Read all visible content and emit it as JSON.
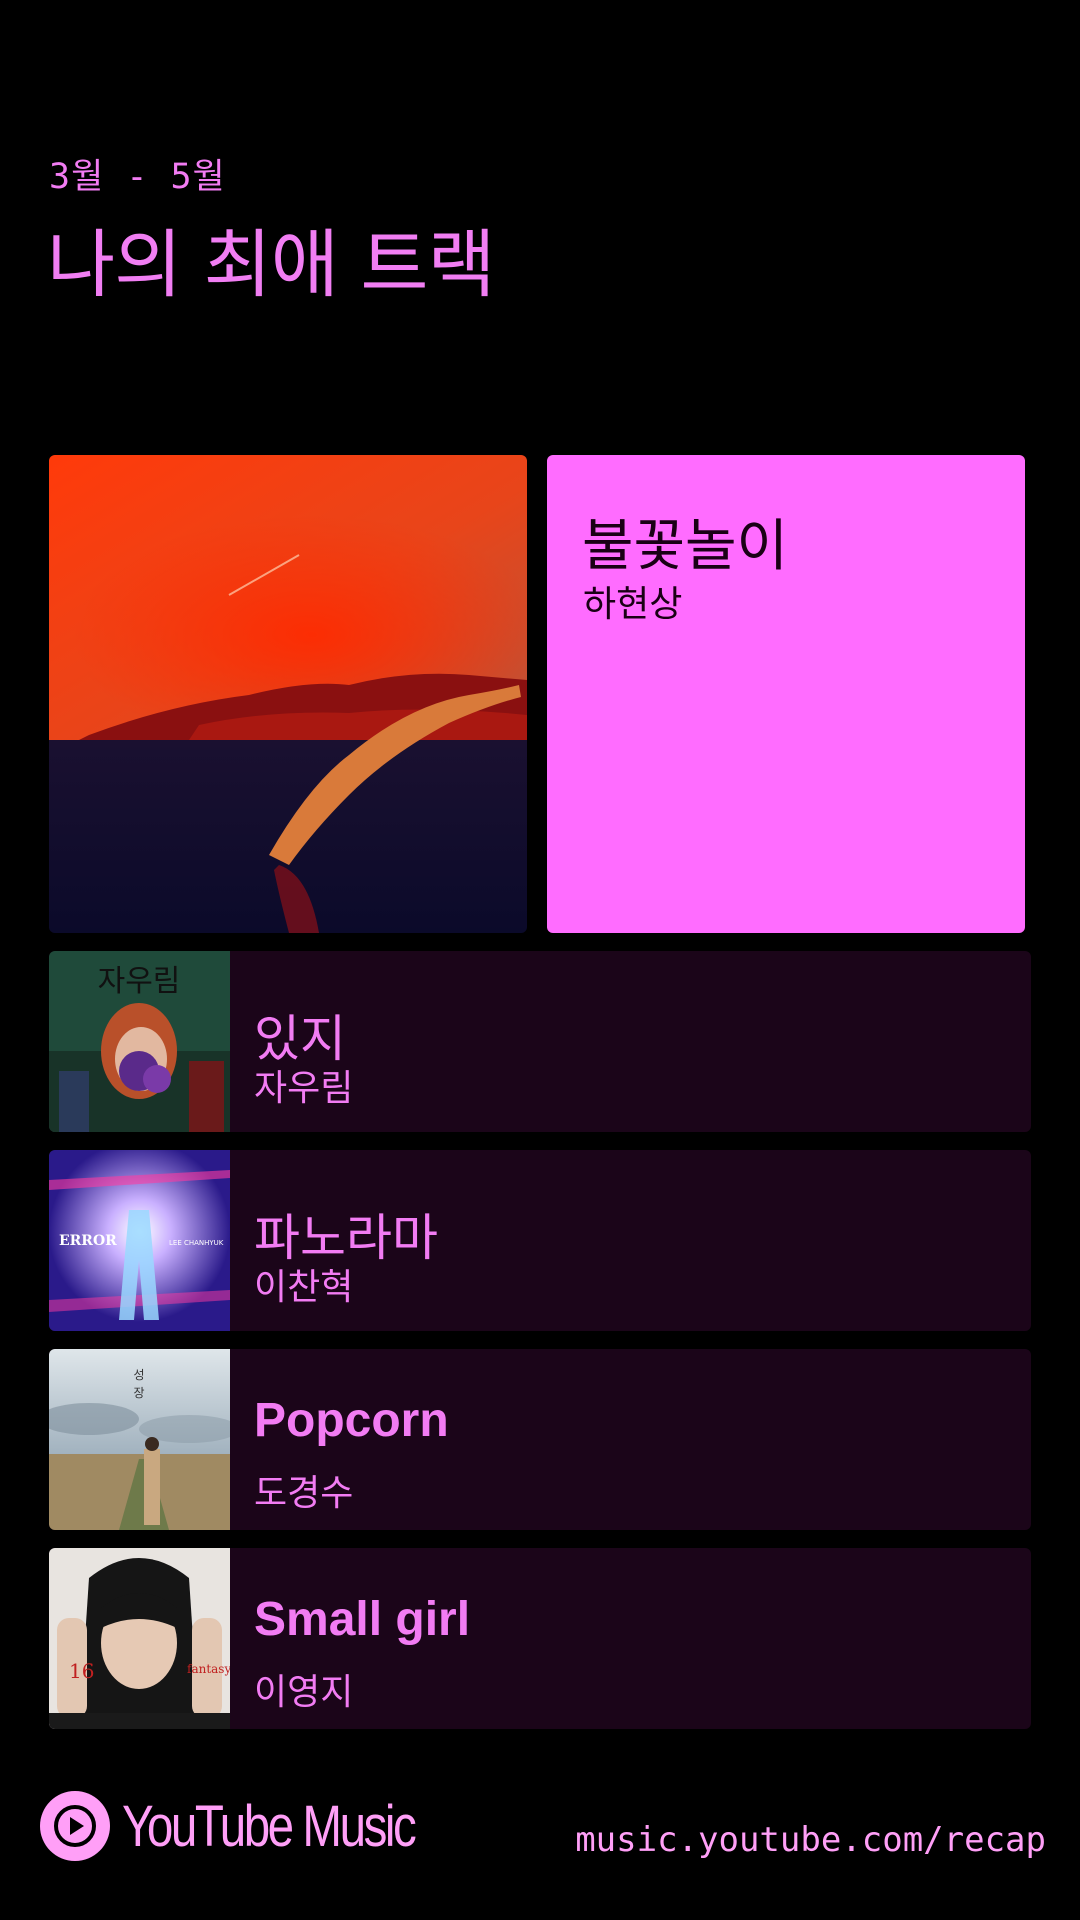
{
  "header": {
    "period": "3월 - 5월",
    "title": "나의 최애 트랙"
  },
  "top_track": {
    "title": "불꽃놀이",
    "artist": "하현상"
  },
  "tracks": [
    {
      "title": "있지",
      "artist": "자우림"
    },
    {
      "title": "파노라마",
      "artist": "이찬혁"
    },
    {
      "title": "Popcorn",
      "artist": "도경수"
    },
    {
      "title": "Small girl",
      "artist": "이영지"
    }
  ],
  "footer": {
    "brand": "YouTube Music",
    "url": "music.youtube.com/recap"
  },
  "colors": {
    "accent": "#f17ef3",
    "card": "#ff6cff",
    "row_bg": "#1b0519",
    "background": "#000000"
  }
}
